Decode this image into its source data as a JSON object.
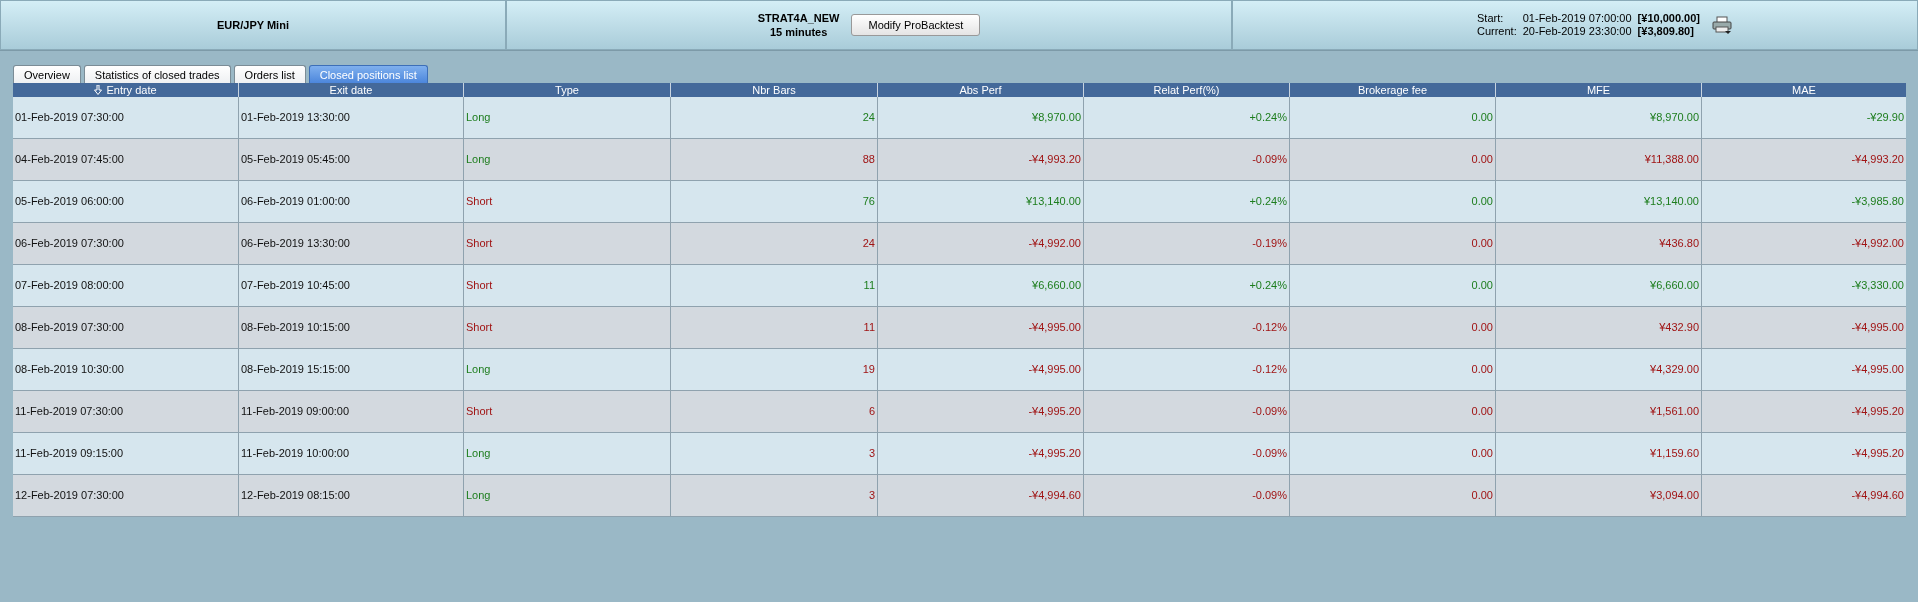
{
  "header": {
    "instrument": "EUR/JPY Mini",
    "strategy": "STRAT4A_NEW",
    "timeframe": "15 minutes",
    "button": "Modify ProBacktest",
    "start_label": "Start:",
    "start_date": "01-Feb-2019 07:00:00",
    "start_capital": "[¥10,000.00]",
    "current_label": "Current:",
    "current_date": "20-Feb-2019 23:30:00",
    "current_capital": "[¥3,809.80]"
  },
  "tabs": [
    {
      "label": "Overview",
      "selected": false
    },
    {
      "label": "Statistics of closed trades",
      "selected": false
    },
    {
      "label": "Orders list",
      "selected": false
    },
    {
      "label": "Closed positions list",
      "selected": true
    }
  ],
  "table": {
    "columns": [
      {
        "label": "Entry date",
        "sorted": true
      },
      {
        "label": "Exit date",
        "sorted": false
      },
      {
        "label": "Type",
        "sorted": false
      },
      {
        "label": "Nbr Bars",
        "sorted": false
      },
      {
        "label": "Abs Perf",
        "sorted": false
      },
      {
        "label": "Relat Perf(%)",
        "sorted": false
      },
      {
        "label": "Brokerage fee",
        "sorted": false
      },
      {
        "label": "MFE",
        "sorted": false
      },
      {
        "label": "MAE",
        "sorted": false
      }
    ],
    "rows": [
      {
        "profitable": true,
        "kind": "long",
        "cells": [
          "01-Feb-2019 07:30:00",
          "01-Feb-2019 13:30:00",
          "Long",
          "24",
          "¥8,970.00",
          "+0.24%",
          "0.00",
          "¥8,970.00",
          "-¥29.90"
        ]
      },
      {
        "profitable": false,
        "kind": "long",
        "cells": [
          "04-Feb-2019 07:45:00",
          "05-Feb-2019 05:45:00",
          "Long",
          "88",
          "-¥4,993.20",
          "-0.09%",
          "0.00",
          "¥11,388.00",
          "-¥4,993.20"
        ]
      },
      {
        "profitable": true,
        "kind": "short",
        "cells": [
          "05-Feb-2019 06:00:00",
          "06-Feb-2019 01:00:00",
          "Short",
          "76",
          "¥13,140.00",
          "+0.24%",
          "0.00",
          "¥13,140.00",
          "-¥3,985.80"
        ]
      },
      {
        "profitable": false,
        "kind": "short",
        "cells": [
          "06-Feb-2019 07:30:00",
          "06-Feb-2019 13:30:00",
          "Short",
          "24",
          "-¥4,992.00",
          "-0.19%",
          "0.00",
          "¥436.80",
          "-¥4,992.00"
        ]
      },
      {
        "profitable": true,
        "kind": "short",
        "cells": [
          "07-Feb-2019 08:00:00",
          "07-Feb-2019 10:45:00",
          "Short",
          "11",
          "¥6,660.00",
          "+0.24%",
          "0.00",
          "¥6,660.00",
          "-¥3,330.00"
        ]
      },
      {
        "profitable": false,
        "kind": "short",
        "cells": [
          "08-Feb-2019 07:30:00",
          "08-Feb-2019 10:15:00",
          "Short",
          "11",
          "-¥4,995.00",
          "-0.12%",
          "0.00",
          "¥432.90",
          "-¥4,995.00"
        ]
      },
      {
        "profitable": false,
        "kind": "long",
        "cells": [
          "08-Feb-2019 10:30:00",
          "08-Feb-2019 15:15:00",
          "Long",
          "19",
          "-¥4,995.00",
          "-0.12%",
          "0.00",
          "¥4,329.00",
          "-¥4,995.00"
        ]
      },
      {
        "profitable": false,
        "kind": "short",
        "cells": [
          "11-Feb-2019 07:30:00",
          "11-Feb-2019 09:00:00",
          "Short",
          "6",
          "-¥4,995.20",
          "-0.09%",
          "0.00",
          "¥1,561.00",
          "-¥4,995.20"
        ]
      },
      {
        "profitable": false,
        "kind": "long",
        "cells": [
          "11-Feb-2019 09:15:00",
          "11-Feb-2019 10:00:00",
          "Long",
          "3",
          "-¥4,995.20",
          "-0.09%",
          "0.00",
          "¥1,159.60",
          "-¥4,995.20"
        ]
      },
      {
        "profitable": false,
        "kind": "long",
        "cells": [
          "12-Feb-2019 07:30:00",
          "12-Feb-2019 08:15:00",
          "Long",
          "3",
          "-¥4,994.60",
          "-0.09%",
          "0.00",
          "¥3,094.00",
          "-¥4,994.60"
        ]
      }
    ]
  }
}
